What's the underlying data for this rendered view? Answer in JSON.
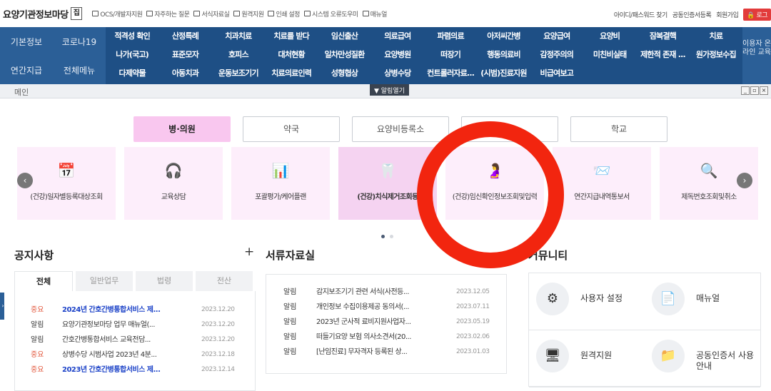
{
  "brand": {
    "title": "요양기관정보마당",
    "home": "집"
  },
  "utils_left": [
    "OCS/개발자지원",
    "자주하는 질문",
    "서식자료실",
    "원격지원",
    "인쇄 설정",
    "시스템 오류도우미",
    "매뉴얼"
  ],
  "utils_right": [
    "아이디/패스워드 찾기",
    "공동인증서등록",
    "회원가입"
  ],
  "logout": "로그",
  "left_menu": [
    [
      "기본정보",
      "코로나19"
    ],
    [
      "연간지급",
      "전체메뉴"
    ]
  ],
  "menu_grid": [
    "적격성 확인",
    "산정특례",
    "치과치료",
    "치료를 받다",
    "임신출산",
    "의료급여",
    "파렴의료",
    "아저씨간병",
    "요양급여",
    "요양비",
    "잠복결핵",
    "치료",
    "나가(국고)",
    "표준모자",
    "호피스",
    "대처현황",
    "일차만성질환",
    "요양병원",
    "떠장기",
    "행동의료비",
    "감정주의의",
    "미친비실태",
    "제한적 존재 ...",
    "원가정보수집",
    "다제약물",
    "아동치과",
    "운동보조기기",
    "치료의료인력",
    "성형협상",
    "상병수당",
    "컨트롤러자료...",
    "(시범)진료지원",
    "비급여보고",
    "",
    "",
    ""
  ],
  "side_edu": "이용자 온라인 교육",
  "breadcrumb": "메인",
  "alert_tab": "▼ 알림열기",
  "win": [
    "_",
    "▫",
    "×"
  ],
  "categories": [
    "병·의원",
    "약국",
    "요양비등록소",
    "",
    "학교"
  ],
  "cards": [
    {
      "label": "(건강)일자별등록대상조회",
      "icon": "calendar-icon",
      "glyph": "📅"
    },
    {
      "label": "교육상담",
      "icon": "headset-icon",
      "glyph": "🎧"
    },
    {
      "label": "포괄평가/케어플랜",
      "icon": "monitor-chart-icon",
      "glyph": "📊"
    },
    {
      "label": "(건강)치식제거조회등",
      "icon": "tooth-icon",
      "glyph": "🦷"
    },
    {
      "label": "(건강)임신확인정보조회및입력",
      "icon": "pregnancy-icon",
      "glyph": "🤰"
    },
    {
      "label": "연간지급내역통보서",
      "icon": "mail-icon",
      "glyph": "📨"
    },
    {
      "label": "제독번호조회및취소",
      "icon": "search-monitor-icon",
      "glyph": "🔍"
    }
  ],
  "notice": {
    "title": "공지사항",
    "tabs": [
      "전체",
      "일반업무",
      "법령",
      "전산"
    ],
    "rows": [
      {
        "type": "중요",
        "text": "2024년 간호간병통합서비스 제...",
        "date": "2023.12.20",
        "imp": true
      },
      {
        "type": "알림",
        "text": "요양기관정보마당 업무 매뉴얼(...",
        "date": "2023.12.20",
        "imp": false
      },
      {
        "type": "알림",
        "text": "간호간병통합서비스 교육전담...",
        "date": "2023.12.20",
        "imp": false
      },
      {
        "type": "중요",
        "text": "상병수당 시범사업 2023년 4분...",
        "date": "2023.12.18",
        "imp": false
      },
      {
        "type": "중요",
        "text": "2023년 간호간병통합서비스 제...",
        "date": "2023.12.14",
        "imp": true
      }
    ]
  },
  "docs": {
    "title": "서류자료실",
    "rows": [
      {
        "type": "알림",
        "text": "감지보조기기 관련 서식(사전등...",
        "date": "2023.12.05"
      },
      {
        "type": "알림",
        "text": "개인정보 수집이용제공 동의서(...",
        "date": "2023.07.11"
      },
      {
        "type": "알림",
        "text": "2023년 군사적 료비지원사업자...",
        "date": "2023.05.19"
      },
      {
        "type": "알림",
        "text": "떠들기요양 보험 의사소견서(20...",
        "date": "2023.02.06"
      },
      {
        "type": "알림",
        "text": "[난임진료] 무자격자 등록된 상...",
        "date": "2023.01.03"
      }
    ]
  },
  "community": {
    "title": "커뮤니티",
    "items": [
      {
        "label": "사용자 설정",
        "icon": "gear-icon",
        "glyph": "⚙"
      },
      {
        "label": "매뉴얼",
        "icon": "manual-icon",
        "glyph": "📄"
      },
      {
        "label": "원격지원",
        "icon": "remote-support-icon",
        "glyph": "🖥"
      },
      {
        "label": "공동인증서 사용안내",
        "icon": "folder-icon",
        "glyph": "📁"
      }
    ]
  },
  "colors": {
    "menu": "#1e4f85",
    "accent_pink": "#f9c7ef",
    "ring": "#f2250f",
    "logout": "#e23b3b"
  }
}
